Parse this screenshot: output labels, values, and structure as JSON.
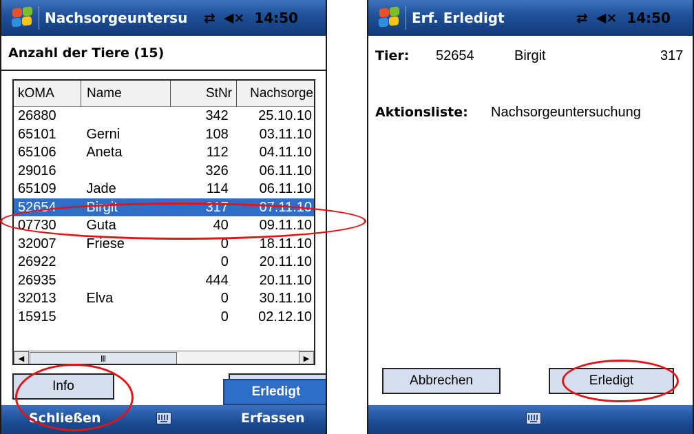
{
  "colors": {
    "title_bar": "#1e4f97",
    "selection": "#2e6dc8",
    "button": "#d4deef",
    "annotation": "#e01515"
  },
  "left": {
    "title": "Nachsorgeuntersu",
    "time": "14:50",
    "heading": "Anzahl der Tiere (15)",
    "columns": [
      "kOMA",
      "Name",
      "StNr",
      "Nachsorge"
    ],
    "rows": [
      [
        "26880",
        "",
        "342",
        "25.10.10"
      ],
      [
        "65101",
        "Gerni",
        "108",
        "03.11.10"
      ],
      [
        "65106",
        "Aneta",
        "112",
        "04.11.10"
      ],
      [
        "29016",
        "",
        "326",
        "06.11.10"
      ],
      [
        "65109",
        "Jade",
        "114",
        "06.11.10"
      ],
      [
        "52654",
        "Birgit",
        "317",
        "07.11.10"
      ],
      [
        "07730",
        "Guta",
        "40",
        "09.11.10"
      ],
      [
        "32007",
        "Friese",
        "0",
        "18.11.10"
      ],
      [
        "26922",
        "",
        "0",
        "20.11.10"
      ],
      [
        "26935",
        "",
        "444",
        "20.11.10"
      ],
      [
        "32013",
        "Elva",
        "0",
        "30.11.10"
      ],
      [
        "15915",
        "",
        "0",
        "02.12.10"
      ]
    ],
    "info_button": "Info",
    "erledigt_button": "Erledigt",
    "softkey_left": "Schließen",
    "softkey_right": "Erfassen",
    "icons": {
      "start": "windows-flag-icon",
      "connectivity": "connectivity-icon",
      "volume": "speaker-muted-icon",
      "keyboard": "keyboard-icon"
    }
  },
  "right": {
    "title": "Erf. Erledigt",
    "time": "14:50",
    "tier_label": "Tier:",
    "tier_id": "52654",
    "tier_name": "Birgit",
    "tier_stnr": "317",
    "aktion_label": "Aktionsliste:",
    "aktion_value": "Nachsorgeuntersuchung",
    "cancel_button": "Abbrechen",
    "done_button": "Erledigt"
  }
}
